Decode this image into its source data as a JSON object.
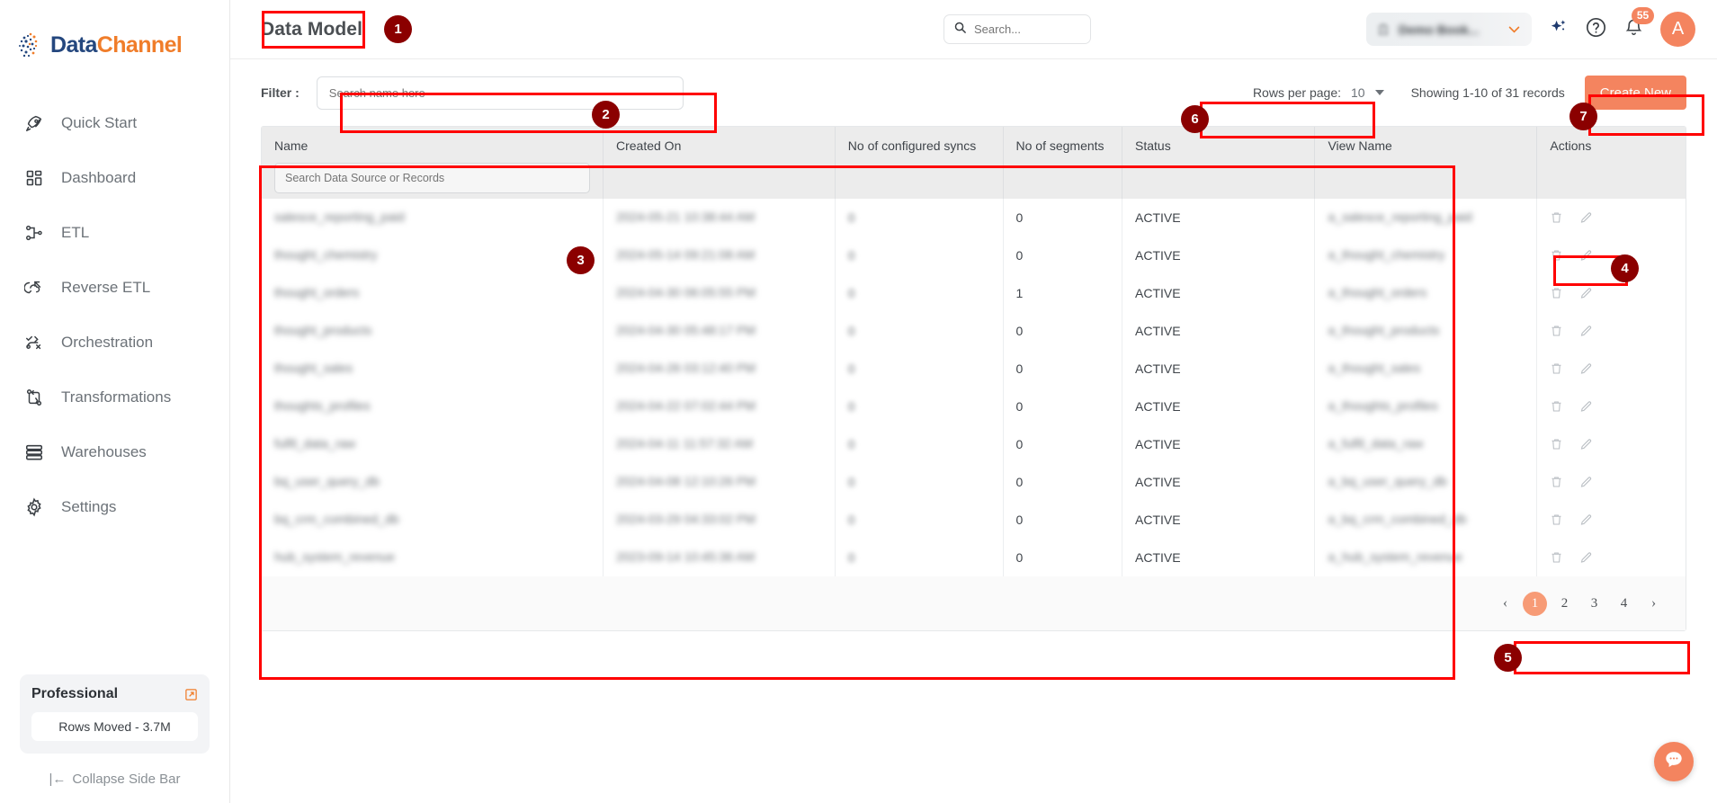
{
  "brand": {
    "name_part1": "Data",
    "name_part2": "Channel"
  },
  "sidebar": {
    "items": [
      {
        "label": "Quick Start",
        "icon": "rocket-icon"
      },
      {
        "label": "Dashboard",
        "icon": "grid-icon"
      },
      {
        "label": "ETL",
        "icon": "etl-icon"
      },
      {
        "label": "Reverse ETL",
        "icon": "reverse-etl-icon"
      },
      {
        "label": "Orchestration",
        "icon": "orchestration-icon"
      },
      {
        "label": "Transformations",
        "icon": "transformations-icon"
      },
      {
        "label": "Warehouses",
        "icon": "warehouse-icon"
      },
      {
        "label": "Settings",
        "icon": "gear-icon"
      }
    ],
    "plan": {
      "name": "Professional",
      "usage": "Rows Moved - 3.7M",
      "external_icon": "external-link-icon"
    },
    "collapse_label": "Collapse Side Bar"
  },
  "header": {
    "title": "Data Model",
    "search_placeholder": "Search...",
    "search_value": "",
    "org_name": "Demo Book...",
    "notifications_count": "55",
    "avatar_initial": "A",
    "icons": {
      "ai": "sparkle-icon",
      "help": "question-circle-icon",
      "bell": "bell-icon"
    }
  },
  "toolbar": {
    "filter_label": "Filter :",
    "filter_placeholder": "Search name here",
    "filter_value": "",
    "rows_per_page_label": "Rows per page:",
    "rows_per_page_value": "10",
    "showing_text": "Showing 1-10 of 31 records",
    "create_label": "Create New"
  },
  "table": {
    "columns": [
      "Name",
      "Created On",
      "No of configured syncs",
      "No of segments",
      "Status",
      "View Name",
      "Actions"
    ],
    "name_search_placeholder": "Search Data Source or Records",
    "rows": [
      {
        "name": "salesce_reporting_paid",
        "created_on": "2024-05-21 10:38:44 AM",
        "syncs": "0",
        "segments": "0",
        "status": "ACTIVE",
        "view_name": "a_salesce_reporting_paid"
      },
      {
        "name": "thought_chemistry",
        "created_on": "2024-05-14 09:21:08 AM",
        "syncs": "0",
        "segments": "0",
        "status": "ACTIVE",
        "view_name": "a_thought_chemistry"
      },
      {
        "name": "thought_orders",
        "created_on": "2024-04-30 06:05:55 PM",
        "syncs": "0",
        "segments": "1",
        "status": "ACTIVE",
        "view_name": "a_thought_orders"
      },
      {
        "name": "thought_products",
        "created_on": "2024-04-30 05:48:17 PM",
        "syncs": "0",
        "segments": "0",
        "status": "ACTIVE",
        "view_name": "a_thought_products"
      },
      {
        "name": "thought_sales",
        "created_on": "2024-04-26 03:12:40 PM",
        "syncs": "0",
        "segments": "0",
        "status": "ACTIVE",
        "view_name": "a_thought_sales"
      },
      {
        "name": "thoughts_profiles",
        "created_on": "2024-04-22 07:02:44 PM",
        "syncs": "0",
        "segments": "0",
        "status": "ACTIVE",
        "view_name": "a_thoughts_profiles"
      },
      {
        "name": "fulfil_data_raw",
        "created_on": "2024-04-11 11:57:32 AM",
        "syncs": "0",
        "segments": "0",
        "status": "ACTIVE",
        "view_name": "a_fulfil_data_raw"
      },
      {
        "name": "bq_user_query_db",
        "created_on": "2024-04-08 12:10:26 PM",
        "syncs": "0",
        "segments": "0",
        "status": "ACTIVE",
        "view_name": "a_bq_user_query_db"
      },
      {
        "name": "bq_crm_combined_db",
        "created_on": "2024-03-29 04:33:02 PM",
        "syncs": "0",
        "segments": "0",
        "status": "ACTIVE",
        "view_name": "a_bq_crm_combined_db"
      },
      {
        "name": "hub_system_revenue",
        "created_on": "2023-09-14 10:45:36 AM",
        "syncs": "0",
        "segments": "0",
        "status": "ACTIVE",
        "view_name": "a_hub_system_revenue"
      }
    ],
    "action_icons": {
      "delete": "trash-icon",
      "edit": "pencil-icon"
    }
  },
  "pagination": {
    "prev": "‹",
    "next": "›",
    "pages": [
      "1",
      "2",
      "3",
      "4"
    ],
    "active": "1"
  },
  "annotations": [
    {
      "num": "1"
    },
    {
      "num": "2"
    },
    {
      "num": "3"
    },
    {
      "num": "4"
    },
    {
      "num": "5"
    },
    {
      "num": "6"
    },
    {
      "num": "7"
    }
  ],
  "chat": {
    "icon": "chat-bubble-icon"
  },
  "colors": {
    "accent": "#f4845f",
    "brand_blue": "#24477e",
    "brand_orange": "#f07d2a",
    "annotation": "#ff0000",
    "annotation_badge": "#8b0000"
  }
}
